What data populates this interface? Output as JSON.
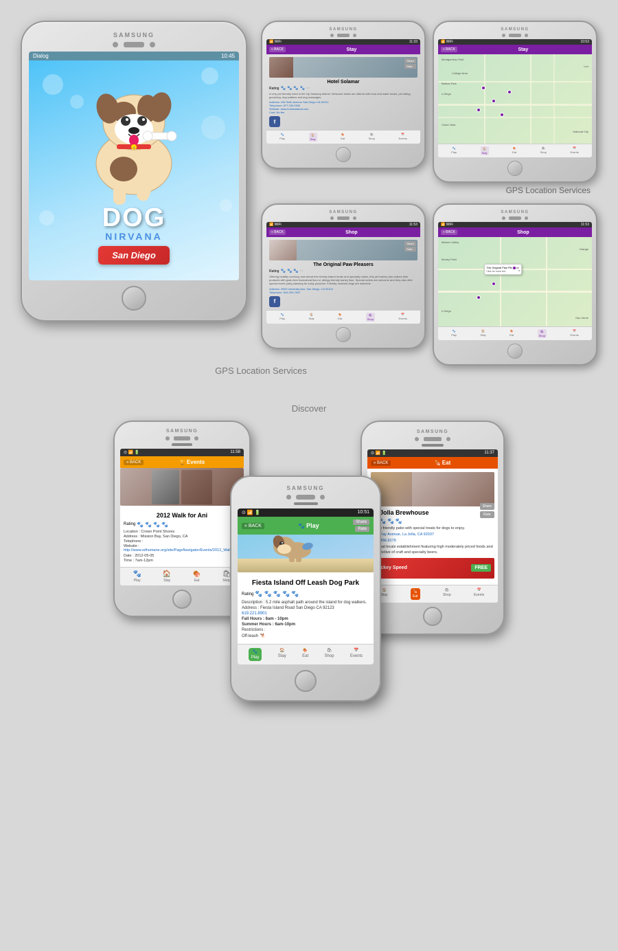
{
  "app": {
    "name": "DOG",
    "subtitle": "NIRVANA",
    "location": "San Diego",
    "tagline": "Dialog"
  },
  "top_phones": {
    "phone1": {
      "time": "10:45",
      "title": "Stay",
      "place": "Hotel Solamar",
      "rating_label": "Rating",
      "description": "A very pet friendly hotel in the hip Gaslamp district. Welcome treats are offered with food and water bowls, pet sitting, grooming, dog walkers and dog massages.",
      "address": "435 Sixth Avenue San Diego CA 92101",
      "telephone": "877.230.0300",
      "website": "www.hotelsolamar.com",
      "cost": "No fee"
    },
    "phone2": {
      "time": "11:33",
      "title": "Stay",
      "map": true
    },
    "phone3": {
      "time": "11:53",
      "title": "Shop",
      "place": "The Original Paw Pleasers",
      "description": "Offering healthy corn/soy and wheat free freshly baked treats and specialty cakes, this pet bakery also makes their products with grain-free buckwheat flour or allergy-friendly barley flour. Special orders are welcome and they also offer special event party planning for lucky pooches. Friendly, leashed dogs are welcome.",
      "address": "2950 University Ave, San Diego, CA 92104",
      "telephone": "619-293-7097"
    },
    "phone4": {
      "time": "11:53",
      "title": "Shop",
      "map": true
    }
  },
  "gps_label": "GPS Location Services",
  "bottom_section": {
    "discover_label": "Discover",
    "events_phone": {
      "time": "11:58",
      "title": "Events",
      "event_name": "2012 Walk for Ani",
      "rating_label": "Rating",
      "location": "Crown Point Shores",
      "address": "Mission Bay, San Diego, CA",
      "telephone": "",
      "website": "http://www.sdhumane.org/site/PageNavigator/Events/2012_Walk/home",
      "date": "2012-05-05",
      "time_field": "7am-12pm"
    },
    "play_phone": {
      "time": "10:51",
      "title": "Play",
      "place": "Fiesta Island Off Leash Dog Park",
      "rating_label": "Rating",
      "description": "5.2 mile asphalt path around the island for dog walkers.",
      "address": "Fiesta Island Road San Diego CA 92123",
      "telephone": "619.221.8901",
      "fall_hours": "6am - 10pm",
      "summer_hours": "6am-10pm",
      "restrictions": "",
      "offleash": "Off-leash"
    },
    "eat_phone": {
      "time": "11:37",
      "title": "Eat",
      "place": "La Jolla Brewhouse",
      "description": "Pet friendly patio with special treats for dogs to enjoy.",
      "address": "7536 Fay Avenue, La Jolla, CA 92037",
      "telephone": "858.456.6279",
      "full_desc": "A casual locals establishment featuring high moderately priced foods and a distinctive of craft and specialty beers.",
      "ad_text": "Hockey Speed",
      "ad_free": "FREE"
    }
  },
  "nav_items": {
    "play": "Play",
    "stay": "Stay",
    "eat": "Eat",
    "shop": "Shop",
    "events": "Events"
  },
  "icons": {
    "paw": "🐾",
    "home": "🏠",
    "bone": "🦴",
    "bag": "🛍",
    "calendar": "📅"
  }
}
